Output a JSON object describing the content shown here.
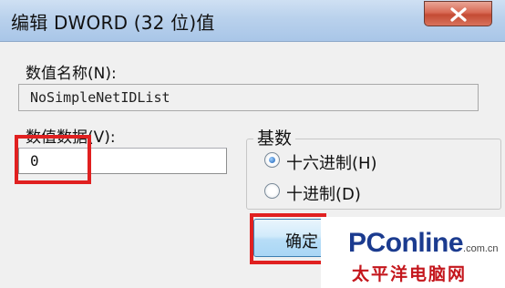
{
  "window": {
    "title": "编辑 DWORD (32 位)值"
  },
  "dialog": {
    "value_name_label": "数值名称(N):",
    "value_name": "NoSimpleNetIDList",
    "value_data_label": "数值数据(V):",
    "value_data": "0",
    "base_label": "基数",
    "radix_options": [
      {
        "label": "十六进制(H)",
        "selected": true
      },
      {
        "label": "十进制(D)",
        "selected": false
      }
    ],
    "ok_label": "确定"
  },
  "watermark": {
    "brand_pc": "PC",
    "brand_online": "online",
    "brand_domain": ".com.cn",
    "brand_cn": "太平洋电脑网"
  },
  "colors": {
    "highlight": "#e02020",
    "brand_blue": "#1b3b8f",
    "brand_red": "#c4161c"
  }
}
